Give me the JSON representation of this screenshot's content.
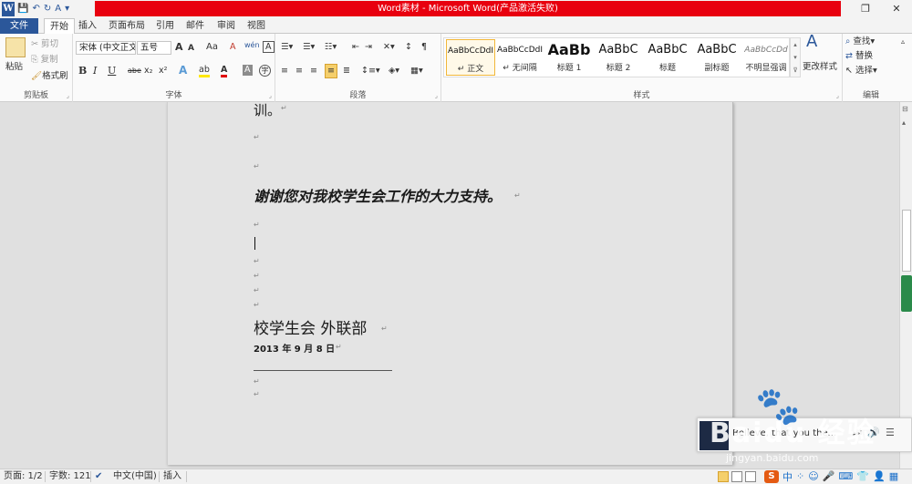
{
  "window": {
    "title": "Word素材 - Microsoft Word(产品激活失败)",
    "controls": {
      "restore": "❐",
      "close": "✕"
    }
  },
  "qat": {
    "app_icon": "W",
    "save": "💾",
    "undo": "↶",
    "redo": "↻",
    "spell": "A",
    "more": "▾"
  },
  "tabs": [
    {
      "label": "文件"
    },
    {
      "label": "开始"
    },
    {
      "label": "插入"
    },
    {
      "label": "页面布局"
    },
    {
      "label": "引用"
    },
    {
      "label": "邮件"
    },
    {
      "label": "审阅"
    },
    {
      "label": "视图"
    }
  ],
  "ribbon": {
    "clipboard": {
      "label": "剪贴板",
      "paste": "粘贴",
      "cut": "剪切",
      "copy": "复制",
      "format_painter": "格式刷"
    },
    "font": {
      "label": "字体",
      "font_name": "宋体 (中文正文",
      "font_size": "五号",
      "grow": "A",
      "shrink": "A",
      "change_case": "Aa",
      "clear": "A",
      "phonetic": "wén",
      "char_border": "A",
      "bold": "B",
      "italic": "I",
      "underline": "U",
      "strike": "abe",
      "subscript": "x₂",
      "superscript": "x²",
      "text_effect": "A",
      "highlight": "ab",
      "font_color": "A",
      "char_shading": "A",
      "enclose": "字"
    },
    "paragraph": {
      "label": "段落"
    },
    "styles": {
      "label": "样式",
      "items": [
        {
          "sample": "AaBbCcDdI",
          "name": "↵ 正文"
        },
        {
          "sample": "AaBbCcDdI",
          "name": "↵ 无间隔"
        },
        {
          "sample": "AaBb",
          "name": "标题 1"
        },
        {
          "sample": "AaBbC",
          "name": "标题 2"
        },
        {
          "sample": "AaBbC",
          "name": "标题"
        },
        {
          "sample": "AaBbC",
          "name": "副标题"
        },
        {
          "sample": "AaBbCcDd",
          "name": "不明显强调"
        }
      ],
      "change_styles": "更改样式"
    },
    "editing": {
      "label": "编辑",
      "find": "查找",
      "replace": "替换",
      "select": "选择"
    }
  },
  "document": {
    "line_top": "训。",
    "thanks": "谢谢您对我校学生会工作的大力支持。",
    "signature": "校学生会  外联部",
    "date": "2013 年 9 月 8 日",
    "para_mark": "↵"
  },
  "statusbar": {
    "page": "页面: 1/2",
    "words": "字数: 121",
    "language": "中文(中国)",
    "mode": "插入"
  },
  "notification": {
    "text": "Believe, that you the..."
  },
  "watermark": {
    "brand": "Baidu 经验",
    "url": "jingyan.baidu.com"
  },
  "tray": {
    "ime": "S",
    "lang": "中"
  }
}
